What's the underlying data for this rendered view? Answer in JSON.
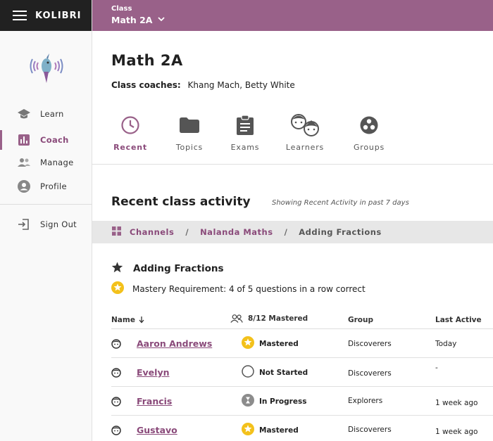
{
  "app": {
    "brand": "KOLIBRI"
  },
  "header": {
    "class_label": "Class",
    "class_name": "Math 2A"
  },
  "sidebar": {
    "items": [
      {
        "label": "Learn"
      },
      {
        "label": "Coach"
      },
      {
        "label": "Manage"
      },
      {
        "label": "Profile"
      }
    ],
    "sign_out": "Sign Out"
  },
  "page": {
    "title": "Math 2A",
    "coaches_label": "Class coaches:",
    "coaches": "Khang Mach, Betty White"
  },
  "tabs": [
    {
      "label": "Recent"
    },
    {
      "label": "Topics"
    },
    {
      "label": "Exams"
    },
    {
      "label": "Learners"
    },
    {
      "label": "Groups"
    }
  ],
  "activity": {
    "title": "Recent class activity",
    "subtitle": "Showing Recent Activity in past 7 days"
  },
  "breadcrumb": [
    "Channels",
    "Nalanda Maths",
    "Adding Fractions"
  ],
  "content": {
    "title": "Adding Fractions",
    "mastery_label": "Mastery Requirement:",
    "mastery_value": "4 of 5 questions in a row correct"
  },
  "table": {
    "headers": {
      "name": "Name",
      "mastered": "8/12 Mastered",
      "group": "Group",
      "last_active": "Last Active"
    },
    "rows": [
      {
        "name": "Aaron Andrews",
        "status": "Mastered",
        "group": "Discoverers",
        "last_active": "Today"
      },
      {
        "name": "Evelyn",
        "status": "Not Started",
        "group": "Discoverers",
        "last_active": "-"
      },
      {
        "name": "Francis",
        "status": "In Progress",
        "group": "Explorers",
        "last_active": "1 week ago"
      },
      {
        "name": "Gustavo",
        "status": "Mastered",
        "group": "Discoverers",
        "last_active": "1 week ago"
      }
    ]
  },
  "colors": {
    "accent": "#996189",
    "mastered": "#f3c11b",
    "in_progress": "#8c8c8c"
  }
}
